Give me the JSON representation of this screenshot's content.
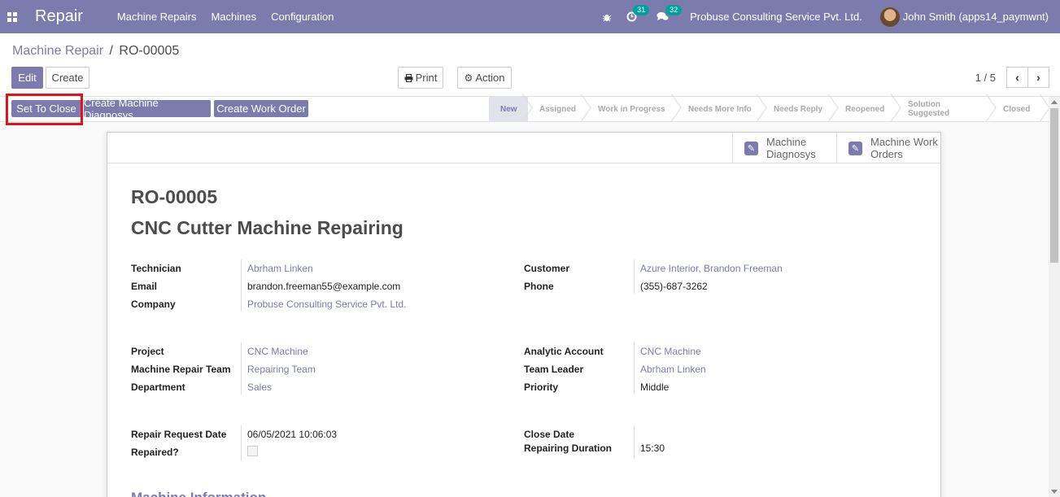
{
  "nav": {
    "brand": "Repair",
    "menu": [
      "Machine Repairs",
      "Machines",
      "Configuration"
    ],
    "activity_count": "31",
    "messages_count": "32",
    "company": "Probuse Consulting Service Pvt. Ltd.",
    "user": "John Smith (apps14_paymwnt)"
  },
  "breadcrumb": {
    "parent": "Machine Repair",
    "separator": "/",
    "current": "RO-00005"
  },
  "buttons": {
    "edit": "Edit",
    "create": "Create",
    "print": "Print",
    "action": "Action"
  },
  "pager": {
    "value": "1 / 5"
  },
  "statusbar": {
    "actions": [
      "Set To Close",
      "Create Machine Diagnosys",
      "Create Work Order"
    ],
    "stages": [
      "New",
      "Assigned",
      "Work in Progress",
      "Needs More Info",
      "Needs Reply",
      "Reopened",
      "Solution Suggested",
      "Closed"
    ],
    "active_stage": "New"
  },
  "smart_buttons": [
    {
      "line1": "Machine",
      "line2": "Diagnosys"
    },
    {
      "line1": "Machine Work",
      "line2": "Orders"
    }
  ],
  "record": {
    "reference": "RO-00005",
    "name": "CNC Cutter Machine Repairing"
  },
  "fields": {
    "technician_label": "Technician",
    "technician": "Abrham Linken",
    "email_label": "Email",
    "email": "brandon.freeman55@example.com",
    "company_label": "Company",
    "company": "Probuse Consulting Service Pvt. Ltd.",
    "customer_label": "Customer",
    "customer": "Azure Interior, Brandon Freeman",
    "phone_label": "Phone",
    "phone": "(355)-687-3262",
    "project_label": "Project",
    "project": "CNC Machine",
    "team_label": "Machine Repair Team",
    "team": "Repairing Team",
    "department_label": "Department",
    "department": "Sales",
    "analytic_label": "Analytic Account",
    "analytic": "CNC Machine",
    "leader_label": "Team Leader",
    "leader": "Abrham Linken",
    "priority_label": "Priority",
    "priority": "Middle",
    "request_date_label": "Repair Request Date",
    "request_date": "06/05/2021 10:06:03",
    "repaired_label": "Repaired?",
    "close_date_label": "Close Date",
    "duration_label": "Repairing Duration",
    "duration": "15:30"
  },
  "section": {
    "machine_info": "Machine Information"
  },
  "colors": {
    "brand": "#7c7bad",
    "highlight": "#e0121a",
    "badge": "#00a09d"
  }
}
